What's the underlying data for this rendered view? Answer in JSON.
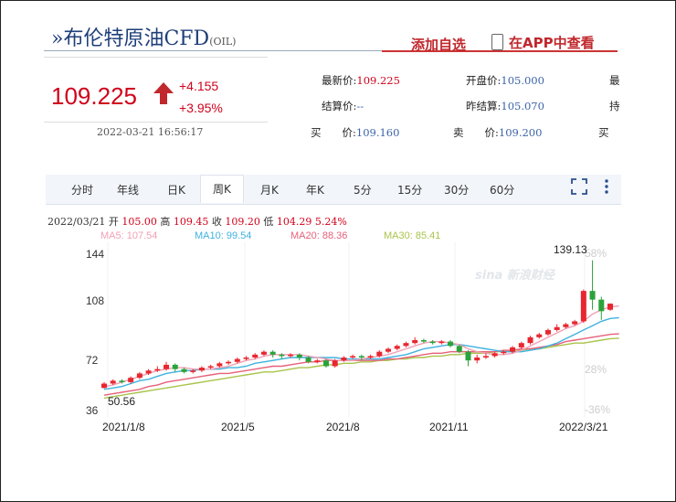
{
  "header": {
    "title": "»布伦特原油CFD",
    "code": "(OIL)",
    "add_favorite": "添加自选",
    "app_view": "在APP中查看"
  },
  "quote": {
    "price": "109.225",
    "change": "+4.155",
    "change_pct": "+3.95%",
    "timestamp": "2022-03-21 16:56:17",
    "latest_label": "最新价:",
    "latest_value": "109.225",
    "open_label": "开盘价:",
    "open_value": "105.000",
    "settle_label": "结算价:",
    "settle_value": "--",
    "prev_settle_label": "昨结算:",
    "prev_settle_value": "105.070",
    "bid_label": "买　　价:",
    "bid_value": "109.160",
    "ask_label": "卖　　价:",
    "ask_value": "109.200",
    "cut_right_1": "最",
    "cut_right_2": "持",
    "cut_right_3": "买"
  },
  "tabs": [
    "分时",
    "年线",
    "日K",
    "周K",
    "月K",
    "年K",
    "5分",
    "15分",
    "30分",
    "60分"
  ],
  "active_tab": "周K",
  "info_bar": {
    "date": "2022/03/21",
    "open_label": "开",
    "open": "105.00",
    "high_label": "高",
    "high": "109.45",
    "close_label": "收",
    "close": "109.20",
    "low_label": "低",
    "low": "104.29",
    "pct": "5.24%"
  },
  "ma_legend": {
    "ma5": "MA5: 107.54",
    "ma10": "MA10: 99.54",
    "ma20": "MA20: 88.36",
    "ma30": "MA30: 85.41"
  },
  "watermark": "sina 新浪财经",
  "colors": {
    "up": "#e8262f",
    "down": "#2aa33a",
    "ma5": "#f2a0b4",
    "ma10": "#3fb2e0",
    "ma20": "#e6617a",
    "ma30": "#a8c44a",
    "price": "#d0021b",
    "brand_red": "#c0282d"
  },
  "chart_data": {
    "type": "candlestick",
    "y_ticks": [
      "144",
      "108",
      "72",
      "36"
    ],
    "pct_ticks": [
      "58%",
      "28%",
      "-36%"
    ],
    "x_ticks": [
      "2021/1/8",
      "2021/5",
      "2021/8",
      "2021/11",
      "2022/3/21"
    ],
    "ylim": [
      36,
      144
    ],
    "high_label": "139.13",
    "low_label": "50.56",
    "candles": [
      {
        "o": 51,
        "c": 54,
        "h": 55,
        "l": 50.56
      },
      {
        "o": 54,
        "c": 56,
        "h": 57,
        "l": 53
      },
      {
        "o": 56,
        "c": 55,
        "h": 57,
        "l": 54
      },
      {
        "o": 55,
        "c": 58,
        "h": 59,
        "l": 54
      },
      {
        "o": 58,
        "c": 61,
        "h": 62,
        "l": 57
      },
      {
        "o": 61,
        "c": 63,
        "h": 64,
        "l": 60
      },
      {
        "o": 63,
        "c": 64,
        "h": 66,
        "l": 62
      },
      {
        "o": 64,
        "c": 67,
        "h": 69,
        "l": 63
      },
      {
        "o": 67,
        "c": 64,
        "h": 68,
        "l": 62
      },
      {
        "o": 64,
        "c": 62,
        "h": 65,
        "l": 61
      },
      {
        "o": 62,
        "c": 63,
        "h": 64,
        "l": 61
      },
      {
        "o": 63,
        "c": 65,
        "h": 66,
        "l": 62
      },
      {
        "o": 65,
        "c": 66,
        "h": 67,
        "l": 64
      },
      {
        "o": 66,
        "c": 68,
        "h": 69,
        "l": 65
      },
      {
        "o": 68,
        "c": 69,
        "h": 70,
        "l": 67
      },
      {
        "o": 69,
        "c": 71,
        "h": 72,
        "l": 68
      },
      {
        "o": 71,
        "c": 72,
        "h": 73,
        "l": 70
      },
      {
        "o": 72,
        "c": 74,
        "h": 75,
        "l": 71
      },
      {
        "o": 74,
        "c": 76,
        "h": 77,
        "l": 73
      },
      {
        "o": 76,
        "c": 74,
        "h": 77,
        "l": 72
      },
      {
        "o": 74,
        "c": 73,
        "h": 75,
        "l": 71
      },
      {
        "o": 73,
        "c": 74,
        "h": 75,
        "l": 72
      },
      {
        "o": 74,
        "c": 72,
        "h": 75,
        "l": 70
      },
      {
        "o": 72,
        "c": 69,
        "h": 73,
        "l": 68
      },
      {
        "o": 69,
        "c": 70,
        "h": 71,
        "l": 68
      },
      {
        "o": 70,
        "c": 66,
        "h": 71,
        "l": 65
      },
      {
        "o": 66,
        "c": 70,
        "h": 71,
        "l": 65
      },
      {
        "o": 70,
        "c": 72,
        "h": 73,
        "l": 69
      },
      {
        "o": 72,
        "c": 73,
        "h": 74,
        "l": 71
      },
      {
        "o": 73,
        "c": 72,
        "h": 74,
        "l": 70
      },
      {
        "o": 72,
        "c": 73,
        "h": 74,
        "l": 71
      },
      {
        "o": 73,
        "c": 76,
        "h": 77,
        "l": 72
      },
      {
        "o": 76,
        "c": 78,
        "h": 79,
        "l": 75
      },
      {
        "o": 78,
        "c": 80,
        "h": 81,
        "l": 77
      },
      {
        "o": 80,
        "c": 82,
        "h": 83,
        "l": 79
      },
      {
        "o": 82,
        "c": 84,
        "h": 86,
        "l": 81
      },
      {
        "o": 84,
        "c": 83,
        "h": 85,
        "l": 82
      },
      {
        "o": 83,
        "c": 82,
        "h": 84,
        "l": 81
      },
      {
        "o": 82,
        "c": 83,
        "h": 84,
        "l": 81
      },
      {
        "o": 83,
        "c": 80,
        "h": 84,
        "l": 79
      },
      {
        "o": 80,
        "c": 76,
        "h": 81,
        "l": 75
      },
      {
        "o": 76,
        "c": 70,
        "h": 77,
        "l": 66
      },
      {
        "o": 70,
        "c": 72,
        "h": 74,
        "l": 68
      },
      {
        "o": 72,
        "c": 73,
        "h": 75,
        "l": 71
      },
      {
        "o": 73,
        "c": 75,
        "h": 76,
        "l": 72
      },
      {
        "o": 75,
        "c": 76,
        "h": 77,
        "l": 74
      },
      {
        "o": 76,
        "c": 79,
        "h": 80,
        "l": 75
      },
      {
        "o": 79,
        "c": 82,
        "h": 83,
        "l": 78
      },
      {
        "o": 82,
        "c": 86,
        "h": 87,
        "l": 81
      },
      {
        "o": 86,
        "c": 88,
        "h": 89,
        "l": 85
      },
      {
        "o": 88,
        "c": 91,
        "h": 92,
        "l": 87
      },
      {
        "o": 91,
        "c": 93,
        "h": 95,
        "l": 90
      },
      {
        "o": 93,
        "c": 95,
        "h": 96,
        "l": 92
      },
      {
        "o": 95,
        "c": 97,
        "h": 98,
        "l": 94
      },
      {
        "o": 97,
        "c": 118,
        "h": 119,
        "l": 96
      },
      {
        "o": 118,
        "c": 112,
        "h": 139.13,
        "l": 105
      },
      {
        "o": 112,
        "c": 104,
        "h": 114,
        "l": 98
      },
      {
        "o": 105,
        "c": 109.2,
        "h": 109.45,
        "l": 104.29
      }
    ],
    "ma5": [
      52,
      53,
      55,
      57,
      59,
      61,
      63,
      64,
      65,
      65,
      64,
      64,
      64,
      65,
      66,
      68,
      70,
      71,
      73,
      74,
      74,
      74,
      74,
      73,
      72,
      71,
      70,
      70,
      70,
      71,
      72,
      73,
      74,
      76,
      78,
      80,
      82,
      83,
      83,
      82,
      81,
      78,
      76,
      75,
      74,
      74,
      75,
      77,
      80,
      83,
      86,
      89,
      92,
      94,
      97,
      102,
      105,
      107,
      107.54
    ],
    "ma10": [
      50,
      51,
      52,
      54,
      56,
      57,
      59,
      61,
      62,
      63,
      63,
      64,
      64,
      64,
      65,
      65,
      66,
      68,
      69,
      70,
      71,
      72,
      72,
      72,
      72,
      72,
      72,
      71,
      71,
      71,
      71,
      71,
      72,
      73,
      74,
      76,
      78,
      79,
      80,
      81,
      81,
      80,
      79,
      78,
      77,
      76,
      76,
      76,
      77,
      78,
      80,
      82,
      85,
      88,
      91,
      94,
      97,
      99,
      99.54
    ],
    "ma20": [
      46,
      47,
      48,
      49,
      50,
      52,
      53,
      55,
      56,
      57,
      58,
      59,
      60,
      61,
      61,
      62,
      63,
      64,
      65,
      66,
      66,
      67,
      68,
      69,
      69,
      70,
      70,
      70,
      70,
      70,
      70,
      70,
      71,
      71,
      72,
      73,
      74,
      75,
      75,
      76,
      76,
      76,
      76,
      76,
      76,
      77,
      77,
      78,
      78,
      79,
      80,
      81,
      83,
      84,
      85,
      86,
      87,
      88,
      88.36
    ],
    "ma30": [
      44,
      45,
      46,
      47,
      48,
      49,
      50,
      51,
      52,
      53,
      54,
      55,
      56,
      57,
      58,
      59,
      60,
      61,
      62,
      62,
      63,
      64,
      65,
      65,
      66,
      67,
      67,
      68,
      68,
      69,
      69,
      70,
      70,
      71,
      71,
      72,
      72,
      73,
      73,
      74,
      74,
      75,
      75,
      75,
      76,
      76,
      77,
      77,
      78,
      78,
      79,
      80,
      81,
      82,
      82,
      83,
      84,
      85,
      85.41
    ]
  }
}
